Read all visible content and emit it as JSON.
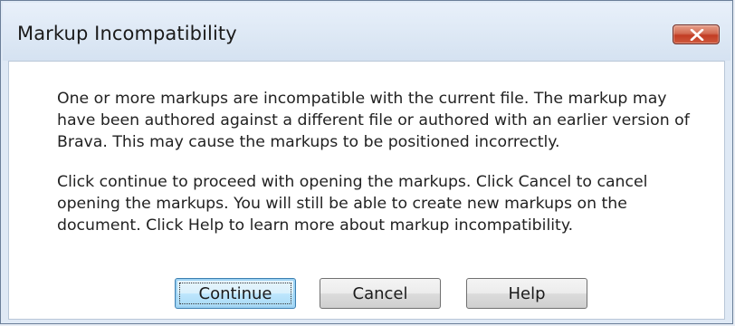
{
  "dialog": {
    "title": "Markup Incompatibility",
    "close_icon": "close-icon",
    "paragraphs": [
      "One or more markups are incompatible with the current file. The markup may have been authored against a different file or authored with an earlier version of Brava. This may cause the markups to be positioned incorrectly.",
      "Click continue to proceed with opening the markups. Click Cancel to cancel opening the markups. You will still be able to create new markups on the document. Click Help to learn more about markup incompatibility."
    ],
    "buttons": {
      "continue_label": "Continue",
      "cancel_label": "Cancel",
      "help_label": "Help"
    }
  },
  "colors": {
    "close_button": "#c23c24",
    "focused_button_border": "#3c7fb1",
    "window_frame": "#dfe9f5"
  }
}
